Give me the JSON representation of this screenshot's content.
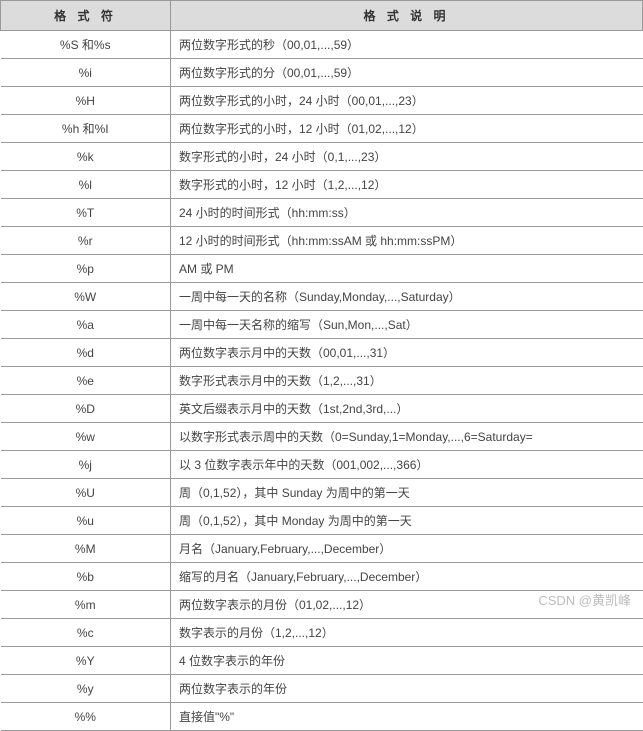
{
  "table": {
    "header": {
      "symbol": "格 式 符",
      "description": "格 式 说 明"
    },
    "rows": [
      {
        "symbol": "%S 和%s",
        "desc": "两位数字形式的秒（00,01,...,59）"
      },
      {
        "symbol": "%i",
        "desc": "两位数字形式的分（00,01,...,59）"
      },
      {
        "symbol": "%H",
        "desc": "两位数字形式的小时，24 小时（00,01,...,23）"
      },
      {
        "symbol": "%h 和%I",
        "desc": "两位数字形式的小时，12 小时（01,02,...,12）"
      },
      {
        "symbol": "%k",
        "desc": "数字形式的小时，24 小时（0,1,...,23）"
      },
      {
        "symbol": "%l",
        "desc": "数字形式的小时，12 小时（1,2,...,12）"
      },
      {
        "symbol": "%T",
        "desc": "24 小时的时间形式（hh:mm:ss）"
      },
      {
        "symbol": "%r",
        "desc": "12 小时的时间形式（hh:mm:ssAM 或 hh:mm:ssPM）"
      },
      {
        "symbol": "%p",
        "desc": "AM 或 PM"
      },
      {
        "symbol": "%W",
        "desc": "一周中每一天的名称（Sunday,Monday,...,Saturday）"
      },
      {
        "symbol": "%a",
        "desc": "一周中每一天名称的缩写（Sun,Mon,...,Sat）"
      },
      {
        "symbol": "%d",
        "desc": "两位数字表示月中的天数（00,01,...,31）"
      },
      {
        "symbol": "%e",
        "desc": "数字形式表示月中的天数（1,2,...,31）"
      },
      {
        "symbol": "%D",
        "desc": "英文后缀表示月中的天数（1st,2nd,3rd,...）"
      },
      {
        "symbol": "%w",
        "desc": "以数字形式表示周中的天数（0=Sunday,1=Monday,...,6=Saturday="
      },
      {
        "symbol": "%j",
        "desc": "以 3 位数字表示年中的天数（001,002,...,366）"
      },
      {
        "symbol": "%U",
        "desc": "周（0,1,52），其中 Sunday 为周中的第一天"
      },
      {
        "symbol": "%u",
        "desc": "周（0,1,52），其中 Monday 为周中的第一天"
      },
      {
        "symbol": "%M",
        "desc": "月名（January,February,...,December）"
      },
      {
        "symbol": "%b",
        "desc": "缩写的月名（January,February,...,December）"
      },
      {
        "symbol": "%m",
        "desc": "两位数字表示的月份（01,02,...,12）"
      },
      {
        "symbol": "%c",
        "desc": "数字表示的月份（1,2,...,12）"
      },
      {
        "symbol": "%Y",
        "desc": "4 位数字表示的年份"
      },
      {
        "symbol": "%y",
        "desc": "两位数字表示的年份"
      },
      {
        "symbol": "%%",
        "desc": "直接值\"%\""
      }
    ]
  },
  "watermark": "CSDN @黄凯峰"
}
